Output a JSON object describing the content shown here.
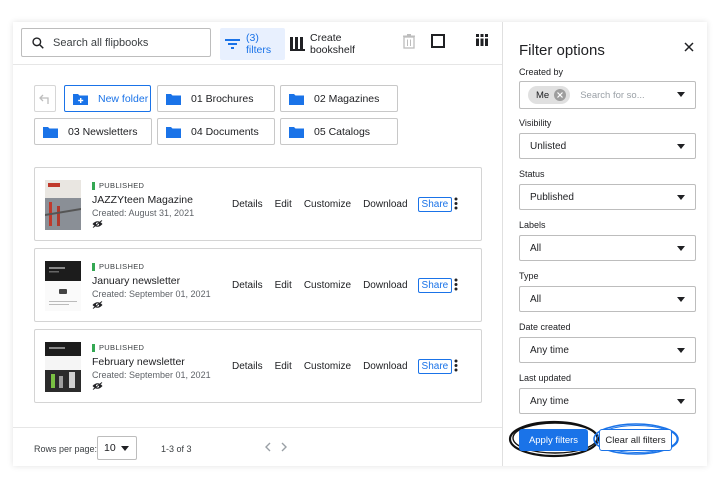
{
  "toolbar": {
    "search_placeholder": "Search all flipbooks",
    "filters_label": "(3) filters",
    "create_bookshelf_label": "Create bookshelf"
  },
  "folders": {
    "new_folder": "New folder",
    "items": [
      "01 Brochures",
      "02 Magazines",
      "03 Newsletters",
      "04 Documents",
      "05 Catalogs"
    ]
  },
  "flipbooks": [
    {
      "status": "PUBLISHED",
      "title": "JAZZYteen Magazine",
      "created": "Created: August 31, 2021"
    },
    {
      "status": "PUBLISHED",
      "title": "January newsletter",
      "created": "Created: September 01, 2021"
    },
    {
      "status": "PUBLISHED",
      "title": "February newsletter",
      "created": "Created: September 01, 2021"
    }
  ],
  "card_actions": {
    "details": "Details",
    "edit": "Edit",
    "customize": "Customize",
    "download": "Download",
    "share": "Share"
  },
  "footer": {
    "rows_per_page_label": "Rows per page:",
    "rows_per_page_value": "10",
    "range": "1-3 of 3"
  },
  "filter_panel": {
    "title": "Filter options",
    "created_by": {
      "label": "Created by",
      "chip": "Me",
      "placeholder": "Search for so..."
    },
    "visibility": {
      "label": "Visibility",
      "value": "Unlisted"
    },
    "status": {
      "label": "Status",
      "value": "Published"
    },
    "labels": {
      "label": "Labels",
      "value": "All"
    },
    "type": {
      "label": "Type",
      "value": "All"
    },
    "date_created": {
      "label": "Date created",
      "value": "Any time"
    },
    "last_updated": {
      "label": "Last updated",
      "value": "Any time"
    },
    "apply_label": "Apply filters",
    "clear_label": "Clear all filters"
  },
  "colors": {
    "accent": "#1a73e8",
    "published": "#34a853",
    "selected_bg": "#e8f0fe"
  },
  "icons": [
    "search-icon",
    "filter-icon",
    "bookshelf-icon",
    "trash-icon",
    "checkbox-icon",
    "grid-view-icon",
    "back-icon",
    "folder-plus-icon",
    "folder-icon",
    "eye-icon",
    "more-vert-icon",
    "chevron-left-icon",
    "chevron-right-icon",
    "caret-down-icon",
    "close-icon"
  ]
}
